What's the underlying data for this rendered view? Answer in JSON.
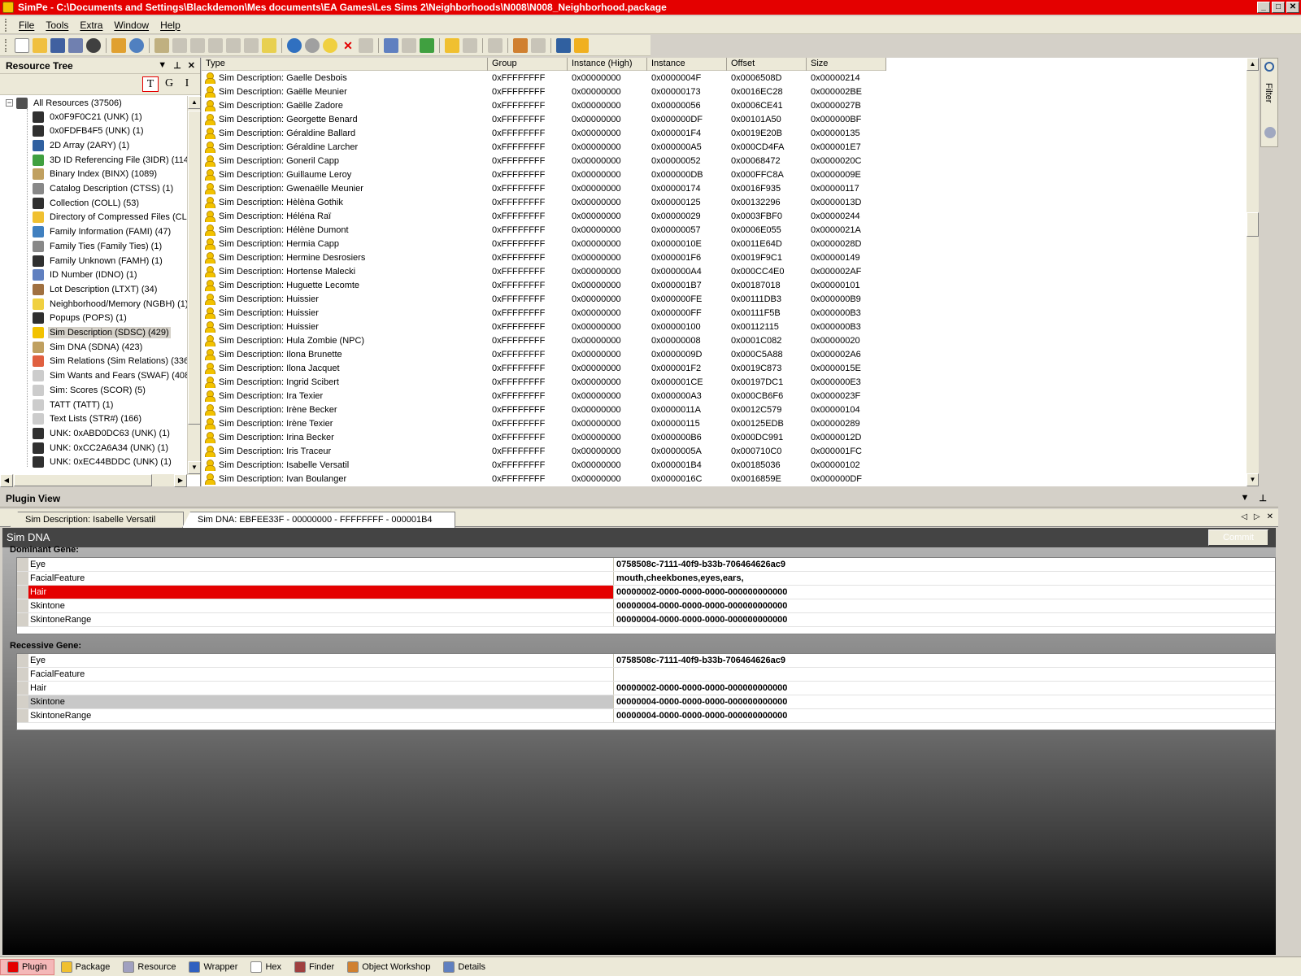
{
  "window": {
    "title": "SimPe - C:\\Documents and Settings\\Blackdemon\\Mes documents\\EA Games\\Les Sims 2\\Neighborhoods\\N008\\N008_Neighborhood.package",
    "minimize": "_",
    "maximize": "□",
    "close": "✕"
  },
  "menu": [
    "File",
    "Tools",
    "Extra",
    "Window",
    "Help"
  ],
  "resource_tree": {
    "title": "Resource Tree",
    "tgi": [
      "T",
      "G",
      "I"
    ],
    "root": "All Resources (37506)",
    "items": [
      "0x0F9F0C21 (UNK) (1)",
      "0x0FDFB4F5 (UNK) (1)",
      "2D Array (2ARY) (1)",
      "3D ID Referencing File (3IDR) (114",
      "Binary Index (BINX) (1089)",
      "Catalog Description (CTSS) (1)",
      "Collection (COLL) (53)",
      "Directory of Compressed Files (CLS",
      "Family Information (FAMI) (47)",
      "Family Ties (Family Ties) (1)",
      "Family Unknown (FAMH) (1)",
      "ID Number (IDNO) (1)",
      "Lot Description (LTXT) (34)",
      "Neighborhood/Memory (NGBH) (1)",
      "Popups (POPS) (1)",
      "Sim Description (SDSC) (429)",
      "Sim DNA (SDNA) (423)",
      "Sim Relations (Sim Relations) (3369",
      "Sim Wants and Fears (SWAF) (408)",
      "Sim: Scores (SCOR) (5)",
      "TATT (TATT) (1)",
      "Text Lists (STR#) (166)",
      "UNK: 0xABD0DC63 (UNK) (1)",
      "UNK: 0xCC2A6A34 (UNK) (1)",
      "UNK: 0xEC44BDDC (UNK) (1)"
    ],
    "selected_index": 15
  },
  "resource_list": {
    "columns": [
      "Type",
      "Group",
      "Instance (High)",
      "Instance",
      "Offset",
      "Size"
    ],
    "rows": [
      [
        "Sim Description: Gaelle Desbois",
        "0xFFFFFFFF",
        "0x00000000",
        "0x0000004F",
        "0x0006508D",
        "0x00000214"
      ],
      [
        "Sim Description: Gaëlle Meunier",
        "0xFFFFFFFF",
        "0x00000000",
        "0x00000173",
        "0x0016EC28",
        "0x000002BE"
      ],
      [
        "Sim Description: Gaëlle Zadore",
        "0xFFFFFFFF",
        "0x00000000",
        "0x00000056",
        "0x0006CE41",
        "0x0000027B"
      ],
      [
        "Sim Description: Georgette Benard",
        "0xFFFFFFFF",
        "0x00000000",
        "0x000000DF",
        "0x00101A50",
        "0x000000BF"
      ],
      [
        "Sim Description: Géraldine Ballard",
        "0xFFFFFFFF",
        "0x00000000",
        "0x000001F4",
        "0x0019E20B",
        "0x00000135"
      ],
      [
        "Sim Description: Géraldine Larcher",
        "0xFFFFFFFF",
        "0x00000000",
        "0x000000A5",
        "0x000CD4FA",
        "0x000001E7"
      ],
      [
        "Sim Description: Goneril Capp",
        "0xFFFFFFFF",
        "0x00000000",
        "0x00000052",
        "0x00068472",
        "0x0000020C"
      ],
      [
        "Sim Description: Guillaume Leroy",
        "0xFFFFFFFF",
        "0x00000000",
        "0x000000DB",
        "0x000FFC8A",
        "0x0000009E"
      ],
      [
        "Sim Description: Gwenaëlle Meunier",
        "0xFFFFFFFF",
        "0x00000000",
        "0x00000174",
        "0x0016F935",
        "0x00000117"
      ],
      [
        "Sim Description: Hèlèna Gothik",
        "0xFFFFFFFF",
        "0x00000000",
        "0x00000125",
        "0x00132296",
        "0x0000013D"
      ],
      [
        "Sim Description: Héléna Raï",
        "0xFFFFFFFF",
        "0x00000000",
        "0x00000029",
        "0x0003FBF0",
        "0x00000244"
      ],
      [
        "Sim Description: Hélène Dumont",
        "0xFFFFFFFF",
        "0x00000000",
        "0x00000057",
        "0x0006E055",
        "0x0000021A"
      ],
      [
        "Sim Description: Hermia Capp",
        "0xFFFFFFFF",
        "0x00000000",
        "0x0000010E",
        "0x0011E64D",
        "0x0000028D"
      ],
      [
        "Sim Description: Hermine Desrosiers",
        "0xFFFFFFFF",
        "0x00000000",
        "0x000001F6",
        "0x0019F9C1",
        "0x00000149"
      ],
      [
        "Sim Description: Hortense Malecki",
        "0xFFFFFFFF",
        "0x00000000",
        "0x000000A4",
        "0x000CC4E0",
        "0x000002AF"
      ],
      [
        "Sim Description: Huguette Lecomte",
        "0xFFFFFFFF",
        "0x00000000",
        "0x000001B7",
        "0x00187018",
        "0x00000101"
      ],
      [
        "Sim Description: Huissier",
        "0xFFFFFFFF",
        "0x00000000",
        "0x000000FE",
        "0x00111DB3",
        "0x000000B9"
      ],
      [
        "Sim Description: Huissier",
        "0xFFFFFFFF",
        "0x00000000",
        "0x000000FF",
        "0x00111F5B",
        "0x000000B3"
      ],
      [
        "Sim Description: Huissier",
        "0xFFFFFFFF",
        "0x00000000",
        "0x00000100",
        "0x00112115",
        "0x000000B3"
      ],
      [
        "Sim Description: Hula Zombie (NPC)",
        "0xFFFFFFFF",
        "0x00000000",
        "0x00000008",
        "0x0001C082",
        "0x00000020"
      ],
      [
        "Sim Description: Ilona Brunette",
        "0xFFFFFFFF",
        "0x00000000",
        "0x0000009D",
        "0x000C5A88",
        "0x000002A6"
      ],
      [
        "Sim Description: Ilona Jacquet",
        "0xFFFFFFFF",
        "0x00000000",
        "0x000001F2",
        "0x0019C873",
        "0x0000015E"
      ],
      [
        "Sim Description: Ingrid Scibert",
        "0xFFFFFFFF",
        "0x00000000",
        "0x000001CE",
        "0x00197DC1",
        "0x000000E3"
      ],
      [
        "Sim Description: Ira Texier",
        "0xFFFFFFFF",
        "0x00000000",
        "0x000000A3",
        "0x000CB6F6",
        "0x0000023F"
      ],
      [
        "Sim Description: Irène Becker",
        "0xFFFFFFFF",
        "0x00000000",
        "0x0000011A",
        "0x0012C579",
        "0x00000104"
      ],
      [
        "Sim Description: Irène Texier",
        "0xFFFFFFFF",
        "0x00000000",
        "0x00000115",
        "0x00125EDB",
        "0x00000289"
      ],
      [
        "Sim Description: Irina Becker",
        "0xFFFFFFFF",
        "0x00000000",
        "0x000000B6",
        "0x000DC991",
        "0x0000012D"
      ],
      [
        "Sim Description: Iris Traceur",
        "0xFFFFFFFF",
        "0x00000000",
        "0x0000005A",
        "0x000710C0",
        "0x000001FC"
      ],
      [
        "Sim Description: Isabelle Versatil",
        "0xFFFFFFFF",
        "0x00000000",
        "0x000001B4",
        "0x00185036",
        "0x00000102"
      ],
      [
        "Sim Description: Ivan Boulanger",
        "0xFFFFFFFF",
        "0x00000000",
        "0x0000016C",
        "0x0016859E",
        "0x000000DF"
      ]
    ]
  },
  "filter_label": "Filter",
  "plugin_view": {
    "title": "Plugin View",
    "tabs": [
      "Sim Description: Isabelle Versatil",
      "Sim DNA: EBFEE33F - 00000000 - FFFFFFFF - 000001B4"
    ],
    "editor_title": "Sim DNA",
    "commit": "Commit",
    "dominant_label": "Dominant Gene:",
    "dominant": [
      {
        "name": "Eye",
        "value": "0758508c-7111-40f9-b33b-706464626ac9"
      },
      {
        "name": "FacialFeature",
        "value": "mouth,cheekbones,eyes,ears,"
      },
      {
        "name": "Hair",
        "value": "00000002-0000-0000-0000-000000000000"
      },
      {
        "name": "Skintone",
        "value": "00000004-0000-0000-0000-000000000000"
      },
      {
        "name": "SkintoneRange",
        "value": "00000004-0000-0000-0000-000000000000"
      }
    ],
    "recessive_label": "Recessive Gene:",
    "recessive": [
      {
        "name": "Eye",
        "value": "0758508c-7111-40f9-b33b-706464626ac9"
      },
      {
        "name": "FacialFeature",
        "value": ""
      },
      {
        "name": "Hair",
        "value": "00000002-0000-0000-0000-000000000000"
      },
      {
        "name": "Skintone",
        "value": "00000004-0000-0000-0000-000000000000"
      },
      {
        "name": "SkintoneRange",
        "value": "00000004-0000-0000-0000-000000000000"
      }
    ]
  },
  "bottom_tabs": [
    "Plugin",
    "Package",
    "Resource",
    "Wrapper",
    "Hex",
    "Finder",
    "Object Workshop",
    "Details"
  ],
  "colors": {
    "accent": "#e40000",
    "chrome": "#ece9d8",
    "selection_gray": "#d4d0c8"
  }
}
